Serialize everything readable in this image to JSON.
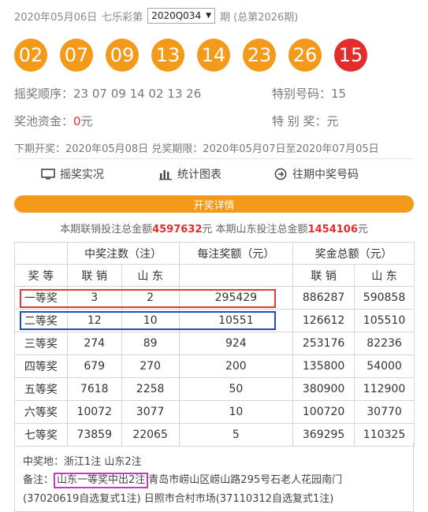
{
  "header": {
    "date": "2020年05月06日",
    "lottery": "七乐彩第",
    "issue_select": "2020Q034",
    "period_suffix": "期 (总第2026期)"
  },
  "balls": {
    "regular": [
      "02",
      "07",
      "09",
      "13",
      "14",
      "23",
      "26"
    ],
    "special": "15",
    "regular_color": "#f39a1b",
    "special_color": "#e32d2d"
  },
  "draw": {
    "order_label": "摇奖顺序：",
    "order_value": "23 07 09 14 02 13 26",
    "special_label": "特别号码：",
    "special_value": "15",
    "pool_label": "奖池资金：",
    "pool_value": "0",
    "pool_unit": "元",
    "special_prize_label": "特 别 奖：",
    "special_prize_value": "元",
    "next_text": "下期开奖：2020年05月08日 兑奖期限：2020年05月07日至2020年07月05日"
  },
  "links": {
    "live": "摇奖实况",
    "charts": "统计图表",
    "history": "往期中奖号码"
  },
  "details_bar": "开奖详情",
  "sales": {
    "text1": "本期联销投注总金额",
    "total": "4597632",
    "text2": "元 本期山东投注总金额",
    "shandong": "1454106",
    "text3": "元"
  },
  "table": {
    "h_winners": "中奖注数（注）",
    "h_per": "每注奖额（元）",
    "h_total": "奖金总额（元）",
    "h_prize": "奖 等",
    "h_joint": "联 销",
    "h_sd": "山 东",
    "h_joint2": "联 销",
    "h_sd2": "山 东",
    "rows": [
      {
        "name": "一等奖",
        "joint": "3",
        "sd": "2",
        "per": "295429",
        "total_joint": "886287",
        "total_sd": "590858"
      },
      {
        "name": "二等奖",
        "joint": "12",
        "sd": "10",
        "per": "10551",
        "total_joint": "126612",
        "total_sd": "105510"
      },
      {
        "name": "三等奖",
        "joint": "274",
        "sd": "89",
        "per": "924",
        "total_joint": "253176",
        "total_sd": "82236"
      },
      {
        "name": "四等奖",
        "joint": "679",
        "sd": "270",
        "per": "200",
        "total_joint": "135800",
        "total_sd": "54000"
      },
      {
        "name": "五等奖",
        "joint": "7618",
        "sd": "2258",
        "per": "50",
        "total_joint": "380900",
        "total_sd": "112900"
      },
      {
        "name": "六等奖",
        "joint": "10072",
        "sd": "3077",
        "per": "10",
        "total_joint": "100720",
        "total_sd": "30770"
      },
      {
        "name": "七等奖",
        "joint": "73859",
        "sd": "22065",
        "per": "5",
        "total_joint": "369295",
        "total_sd": "110325"
      }
    ]
  },
  "notes": {
    "winners": "中奖地：浙江1注 山东2注",
    "remark_label": "备注：",
    "remark_highlight": "山东一等奖中出2注",
    "remark_rest": "青岛市崂山区崂山路295号石老人花园南门",
    "remark_line2": "(37020619自选复式1注) 日照市合村市场(37110312自选复式1注)"
  }
}
